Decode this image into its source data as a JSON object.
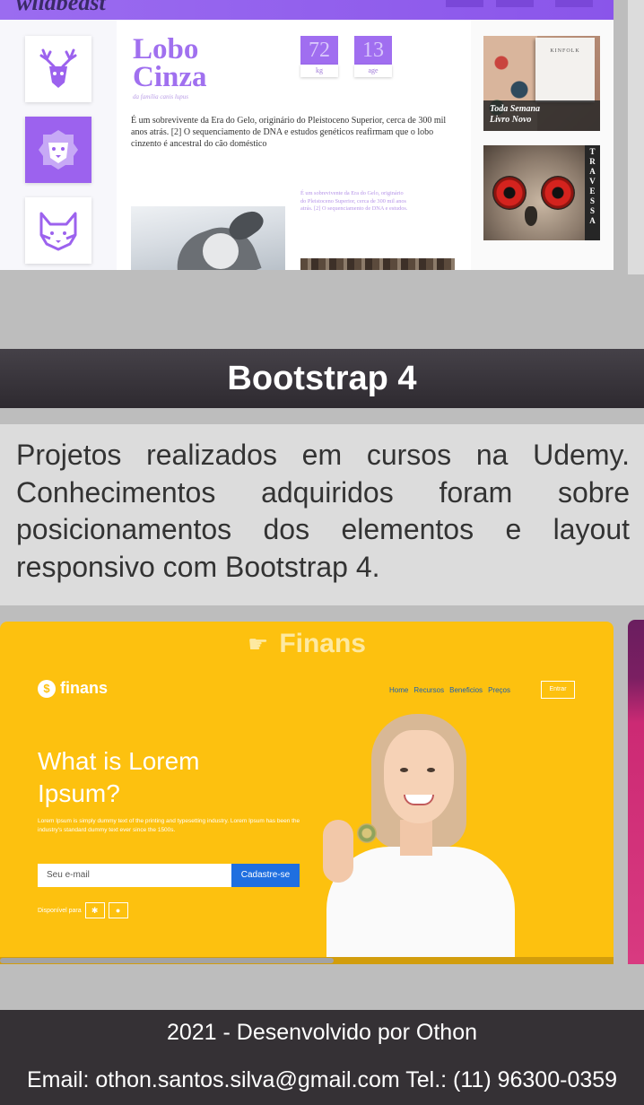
{
  "wolf_preview": {
    "brand": "wildbeast",
    "title_line1": "Lobo",
    "title_line2": "Cinza",
    "subtitle": "da família canis lupus",
    "stats": [
      {
        "value": "72",
        "label": "kg"
      },
      {
        "value": "13",
        "label": "age"
      }
    ],
    "paragraph": "É um sobrevivente da Era do Gelo, originário do Pleistoceno Superior, cerca de 300 mil anos atrás. [2] O sequenciamento de DNA e estudos genéticos reafirmam que o lobo cinzento é ancestral do cão doméstico",
    "small_text": "É um sobrevivente da Era do Gelo, originário do Pleistoceno Superior, cerca de 300 mil anos atrás. [2] O sequenciamento de DNA e estudos.",
    "book_brand": "KINFOLK",
    "book_caption_line1": "Toda Semana",
    "book_caption_line2": "Livro Novo",
    "vertical_label": [
      "T",
      "R",
      "A",
      "V",
      "E",
      "S",
      "S",
      "A"
    ],
    "side_icons": [
      "deer-icon",
      "lion-icon",
      "fox-icon"
    ]
  },
  "section": {
    "title": "Bootstrap 4",
    "description": "Projetos realizados em cursos na Udemy. Conhecimentos adquiridos foram sobre posicionamentos dos elementos e layout responsivo com Bootstrap 4."
  },
  "finans_preview": {
    "title": "Finans",
    "title_icon": "pointing-hand-icon",
    "logo_text": "finans",
    "logo_symbol": "$",
    "nav": [
      "Home",
      "Recursos",
      "Beneficios",
      "Preços"
    ],
    "enter_label": "Entrar",
    "headline": "What is Lorem Ipsum?",
    "body": "Lorem Ipsum is simply dummy text of the printing and typesetting industry. Lorem Ipsum has been the industry's standard dummy text ever since the 1500s.",
    "email_placeholder": "Seu e-mail",
    "signup_label": "Cadastre-se",
    "available_label": "Disponível para",
    "stores": [
      "android-icon",
      "apple-icon"
    ],
    "accent_color": "#fdc10f"
  },
  "footer": {
    "line1": "2021 - Desenvolvido por Othon",
    "line2": "Email: othon.santos.silva@gmail.com Tel.: (11) 96300-0359"
  }
}
